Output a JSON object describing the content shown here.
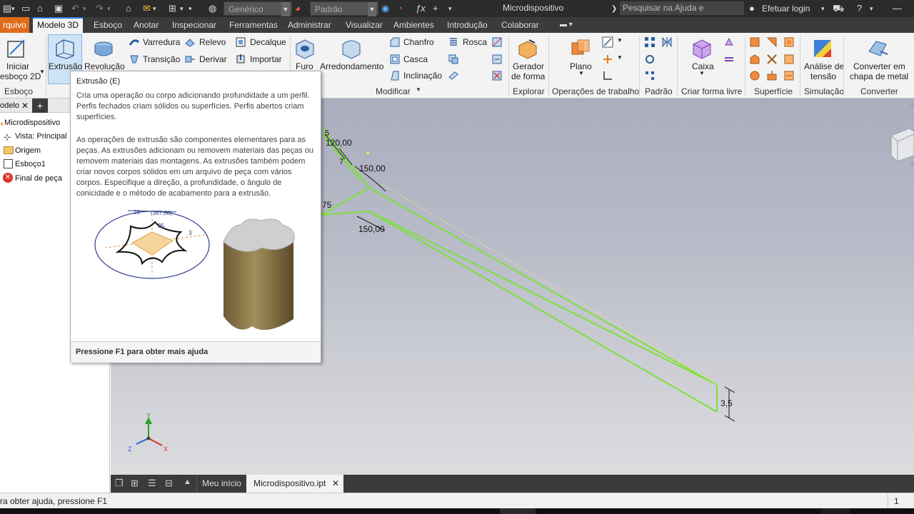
{
  "titlebar": {
    "app_title": "Microdispositivo",
    "material_combo": "Genérico",
    "appearance_combo": "Padrão",
    "search_placeholder": "Pesquisar na Ajuda e comandos...",
    "login_label": "Efetuar login",
    "icons": [
      "new-file-icon",
      "open-icon",
      "save-icon",
      "undo-icon",
      "redo-icon",
      "home-icon",
      "project-icon",
      "select-icon",
      "update-icon",
      "color-wheel-icon",
      "appearance-icon",
      "clear-appearance-icon",
      "fx-icon",
      "plus-icon",
      "cart-icon",
      "help-icon"
    ]
  },
  "tabs": [
    {
      "label": "rquivo"
    },
    {
      "label": "Modelo 3D"
    },
    {
      "label": "Esboço"
    },
    {
      "label": "Anotar"
    },
    {
      "label": "Inspecionar"
    },
    {
      "label": "Ferramentas"
    },
    {
      "label": "Administrar"
    },
    {
      "label": "Visualizar"
    },
    {
      "label": "Ambientes"
    },
    {
      "label": "Introdução"
    },
    {
      "label": "Colaborar"
    }
  ],
  "ribbon": {
    "start_sketch": {
      "line1": "Iniciar",
      "line2": "esboço 2D"
    },
    "extrude": "Extrusão",
    "revolve": "Revolução",
    "sweep": "Varredura",
    "emboss": "Relevo",
    "decal": "Decalque",
    "loft": "Transição",
    "derive": "Derivar",
    "import": "Importar",
    "hole": "Furo",
    "fillet": "Arredondamento",
    "chamfer": "Chanfro",
    "thread": "Rosca",
    "shell": "Casca",
    "draft": "Inclinação",
    "shape_generator": {
      "line1": "Gerador",
      "line2": "de forma"
    },
    "plane": "Plano",
    "box": "Caixa",
    "stress_analysis": {
      "line1": "Análise de",
      "line2": "tensão"
    },
    "convert_sheet_metal": {
      "line1": "Converter em",
      "line2": "chapa de metal"
    },
    "groups": {
      "sketch": "Esboço",
      "modify": "Modificar",
      "explore": "Explorar",
      "work_features": "Operações de trabalho",
      "pattern": "Padrão",
      "freeform": "Criar forma livre",
      "surface": "Superfície",
      "simulation": "Simulação",
      "convert": "Converter"
    }
  },
  "browser": {
    "tab_label": "odelo",
    "items": [
      {
        "label": "Microdispositivo",
        "icon": "part-icon"
      },
      {
        "label": "Vista: Principal",
        "icon": "view-icon"
      },
      {
        "label": "Origem",
        "icon": "folder-icon"
      },
      {
        "label": "Esboço1",
        "icon": "sketch-icon"
      },
      {
        "label": "Final de peça",
        "icon": "end-of-part-icon"
      }
    ]
  },
  "tooltip": {
    "title": "Extrusão (E)",
    "para1": "Cria uma operação ou corpo adicionando profundidade a um perfil. Perfis fechados criam sólidos ou superfícies. Perfis abertos criam superfícies.",
    "para2": "As operações de extrusão são componentes elementares para as peças. As extrusões adicionam ou removem materiais das peças ou removem materiais das montagens. As extrusões também podem criar novos corpos sólidos em um arquivo de peça com vários corpos. Especifique a direção, a profundidade, o ângulo de conicidade e o método de acabamento para a extrusão.",
    "illus_dims": {
      "d1": "25",
      "d2": "(367,00)",
      "d3": "25",
      "d4": "3"
    },
    "footer": "Pressione F1 para obter mais ajuda"
  },
  "viewport": {
    "dims": {
      "d1": "120,00",
      "d2": "150,00",
      "d3": "150,00",
      "d4": "3,5",
      "d5": "75",
      "d6": "5",
      "d7": "7"
    },
    "triad": {
      "x": "X",
      "y": "Y",
      "z": "Z"
    },
    "colors": {
      "sketch": "#7de03a",
      "dims": "#111111"
    }
  },
  "doc_tabs": {
    "home": "Meu início",
    "document": "Microdispositivo.ipt"
  },
  "status": {
    "message": "ra obter ajuda, pressione F1",
    "count": "1"
  }
}
